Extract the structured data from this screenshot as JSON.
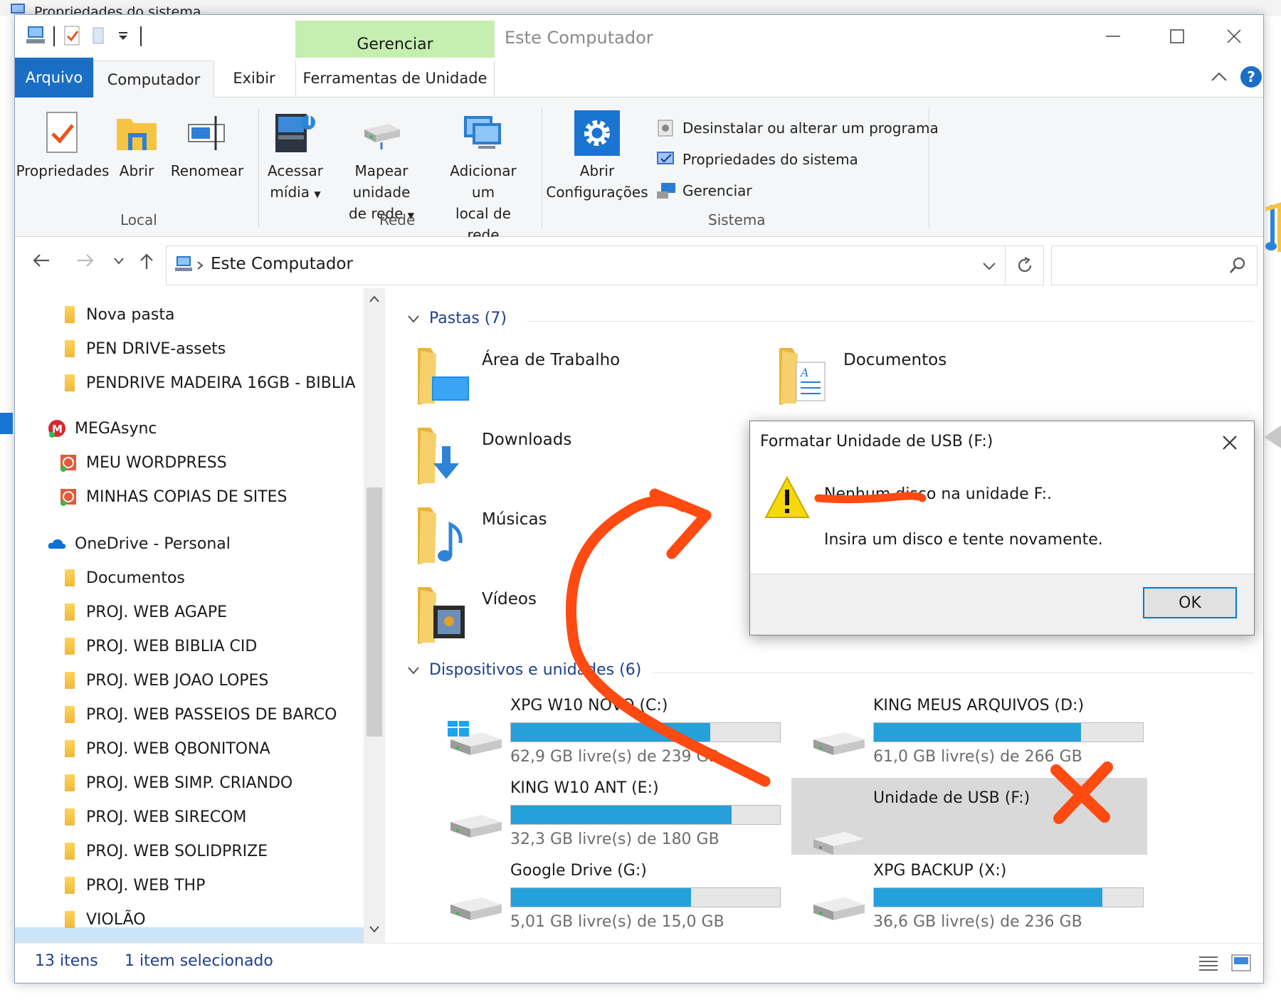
{
  "background_window": {
    "title": "Propriedades do sistema"
  },
  "window": {
    "title": "Este Computador",
    "contextual_tab_group": "Gerenciar"
  },
  "ribbon_tabs": {
    "arquivo": "Arquivo",
    "computador": "Computador",
    "exibir": "Exibir",
    "ferramentas": "Ferramentas de Unidade"
  },
  "help": "?",
  "ribbon": {
    "local": {
      "label": "Local",
      "propriedades": "Propriedades",
      "abrir": "Abrir",
      "renomear": "Renomear"
    },
    "rede": {
      "label": "Rede",
      "acessar_l1": "Acessar",
      "acessar_l2": "mídia",
      "mapear_l1": "Mapear unidade",
      "mapear_l2": "de rede",
      "adicionar_l1": "Adicionar um",
      "adicionar_l2": "local de rede"
    },
    "sistema": {
      "label": "Sistema",
      "abrir_l1": "Abrir",
      "abrir_l2": "Configurações",
      "desinstalar": "Desinstalar ou alterar um programa",
      "propriedades_sistema": "Propriedades do sistema",
      "gerenciar": "Gerenciar"
    }
  },
  "address": {
    "path": "Este Computador"
  },
  "nav_pane": {
    "items": [
      {
        "label": "Nova pasta",
        "kind": "folder"
      },
      {
        "label": "PEN DRIVE-assets",
        "kind": "folder"
      },
      {
        "label": "PENDRIVE MADEIRA 16GB - BIBLIA",
        "kind": "folder"
      },
      {
        "label": "MEGAsync",
        "kind": "mega"
      },
      {
        "label": "MEU WORDPRESS",
        "kind": "sync"
      },
      {
        "label": "MINHAS COPIAS DE SITES",
        "kind": "sync"
      },
      {
        "label": "OneDrive - Personal",
        "kind": "onedrive"
      },
      {
        "label": "Documentos",
        "kind": "folder"
      },
      {
        "label": "PROJ. WEB AGAPE",
        "kind": "folder"
      },
      {
        "label": "PROJ. WEB BIBLIA CID",
        "kind": "folder"
      },
      {
        "label": "PROJ. WEB JOAO LOPES",
        "kind": "folder"
      },
      {
        "label": "PROJ. WEB PASSEIOS DE BARCO",
        "kind": "folder"
      },
      {
        "label": "PROJ. WEB QBONITONA",
        "kind": "folder"
      },
      {
        "label": "PROJ. WEB SIMP. CRIANDO",
        "kind": "folder"
      },
      {
        "label": "PROJ. WEB SIRECOM",
        "kind": "folder"
      },
      {
        "label": "PROJ. WEB SOLIDPRIZE",
        "kind": "folder"
      },
      {
        "label": "PROJ. WEB THP",
        "kind": "folder"
      },
      {
        "label": "VIOLÃO",
        "kind": "folder"
      }
    ]
  },
  "content": {
    "folders_header": "Pastas (7)",
    "folders": [
      {
        "label": "Área de Trabalho",
        "icon": "desktop-folder-icon"
      },
      {
        "label": "Documentos",
        "icon": "documents-folder-icon"
      },
      {
        "label": "Downloads",
        "icon": "downloads-folder-icon"
      },
      {
        "label": "Músicas",
        "icon": "music-folder-icon"
      },
      {
        "label": "Vídeos",
        "icon": "videos-folder-icon"
      }
    ],
    "devices_header": "Dispositivos e unidades (6)",
    "drives": [
      {
        "label": "XPG W10 NOVO (C:)",
        "free": "62,9 GB livre(s) de 239 GB",
        "used_fraction": 0.74,
        "icon": "windows-drive-icon"
      },
      {
        "label": "KING MEUS ARQUIVOS (D:)",
        "free": "61,0 GB livre(s) de 266 GB",
        "used_fraction": 0.77,
        "icon": "hard-drive-icon"
      },
      {
        "label": "KING W10 ANT (E:)",
        "free": "32,3 GB livre(s) de 180 GB",
        "used_fraction": 0.82,
        "icon": "hard-drive-icon"
      },
      {
        "label": "Unidade de USB (F:)",
        "icon": "usb-drive-icon"
      },
      {
        "label": "Google Drive (G:)",
        "free": "5,01 GB livre(s) de 15,0 GB",
        "used_fraction": 0.67,
        "icon": "hard-drive-icon"
      },
      {
        "label": "XPG BACKUP (X:)",
        "free": "36,6 GB livre(s) de 236 GB",
        "used_fraction": 0.85,
        "icon": "hard-drive-icon"
      }
    ]
  },
  "status_bar": {
    "count": "13 itens",
    "selected": "1 item selecionado"
  },
  "dialog": {
    "title": "Formatar Unidade de USB (F:)",
    "message": "Nenhum disco na unidade F:.",
    "detail": "Insira um disco e tente novamente.",
    "ok_label": "OK"
  },
  "colors": {
    "accent": "#1a6fc4",
    "drive_bar": "#26a0da",
    "annotation": "#ff4a12",
    "contextual_tab": "#c5efb0"
  }
}
